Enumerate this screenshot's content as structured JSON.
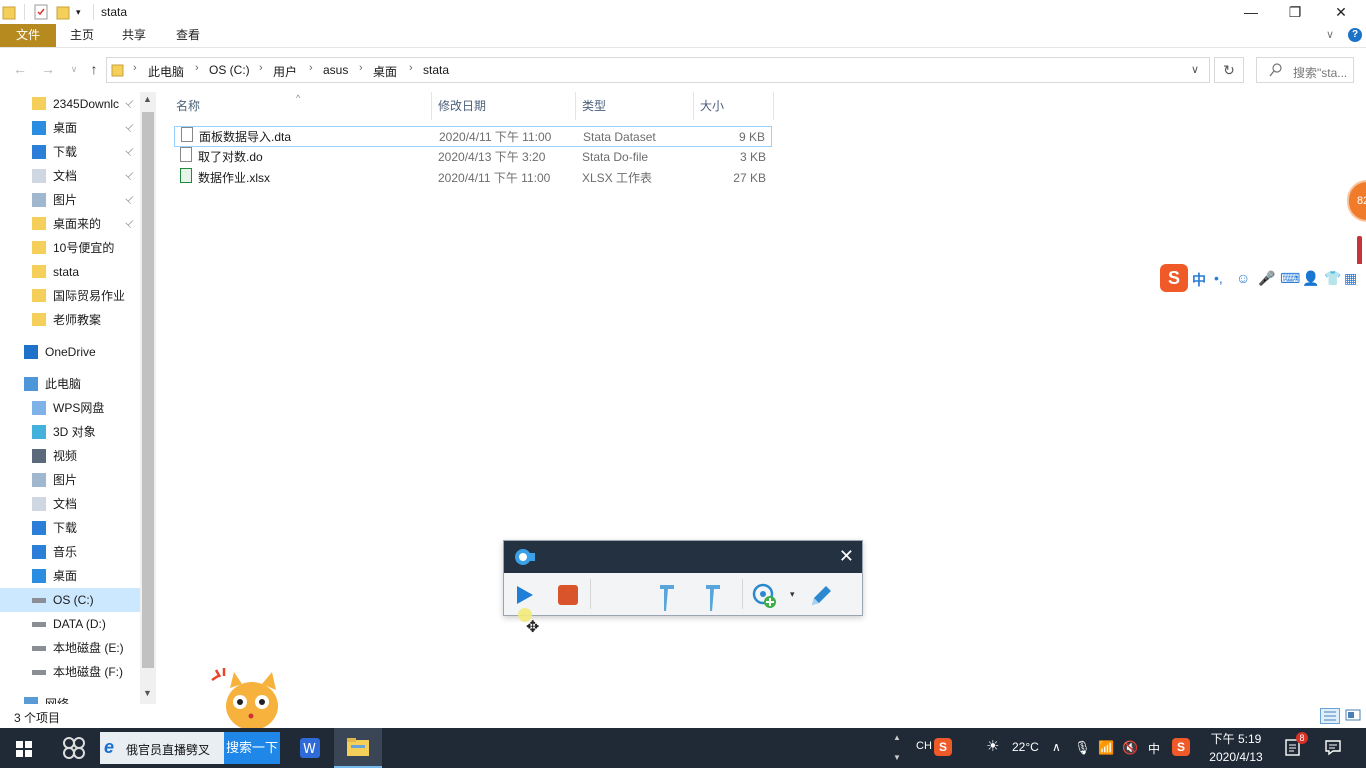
{
  "window": {
    "title": "stata",
    "minimize_icon": "minimize-icon",
    "maximize_icon": "restore-icon",
    "close_icon": "close-icon",
    "min_glyph": "—",
    "max_glyph": "❐",
    "close_glyph": "✕"
  },
  "ribbon": {
    "tabs": [
      "文件",
      "主页",
      "共享",
      "查看"
    ],
    "help_glyph": "?",
    "expand_glyph": "∨"
  },
  "address": {
    "crumbs": [
      "此电脑",
      "OS (C:)",
      "用户",
      "asus",
      "桌面",
      "stata"
    ],
    "dropdown_glyph": "∨",
    "refresh_glyph": "↻",
    "search_placeholder": "搜索\"sta..."
  },
  "sidebar": {
    "items": [
      {
        "label": "2345Downlc",
        "pinned": true,
        "icon": "folder-icon"
      },
      {
        "label": "桌面",
        "pinned": true,
        "icon": "desktop-icon"
      },
      {
        "label": "下载",
        "pinned": true,
        "icon": "download-icon"
      },
      {
        "label": "文档",
        "pinned": true,
        "icon": "document-icon"
      },
      {
        "label": "图片",
        "pinned": true,
        "icon": "picture-icon"
      },
      {
        "label": "桌面来的",
        "pinned": true,
        "icon": "folder-icon"
      },
      {
        "label": "10号便宜的",
        "pinned": false,
        "icon": "folder-icon"
      },
      {
        "label": "stata",
        "pinned": false,
        "icon": "folder-icon"
      },
      {
        "label": "国际贸易作业",
        "pinned": false,
        "icon": "folder-icon"
      },
      {
        "label": "老师教案",
        "pinned": false,
        "icon": "folder-icon"
      },
      {
        "label": "OneDrive",
        "pinned": false,
        "icon": "cloud-icon"
      },
      {
        "label": "此电脑",
        "pinned": false,
        "icon": "computer-icon"
      },
      {
        "label": "WPS网盘",
        "pinned": false,
        "icon": "cloud-outline-icon"
      },
      {
        "label": "3D 对象",
        "pinned": false,
        "icon": "cube-icon"
      },
      {
        "label": "视频",
        "pinned": false,
        "icon": "video-icon"
      },
      {
        "label": "图片",
        "pinned": false,
        "icon": "picture-icon"
      },
      {
        "label": "文档",
        "pinned": false,
        "icon": "document-icon"
      },
      {
        "label": "下载",
        "pinned": false,
        "icon": "download-icon"
      },
      {
        "label": "音乐",
        "pinned": false,
        "icon": "music-icon"
      },
      {
        "label": "桌面",
        "pinned": false,
        "icon": "desktop-icon"
      },
      {
        "label": "OS (C:)",
        "pinned": false,
        "icon": "drive-icon",
        "selected": true
      },
      {
        "label": "DATA (D:)",
        "pinned": false,
        "icon": "drive-icon"
      },
      {
        "label": "本地磁盘 (E:)",
        "pinned": false,
        "icon": "drive-icon"
      },
      {
        "label": "本地磁盘 (F:)",
        "pinned": false,
        "icon": "drive-icon"
      },
      {
        "label": "网络",
        "pinned": false,
        "icon": "network-icon"
      }
    ],
    "pin_glyph": "📌"
  },
  "filelist": {
    "columns": [
      "名称",
      "修改日期",
      "类型",
      "大小"
    ],
    "files": [
      {
        "name": "面板数据导入.dta",
        "date": "2020/4/11 下午 11:00",
        "type": "Stata Dataset",
        "size": "9 KB",
        "icon": "file-icon"
      },
      {
        "name": "取了对数.do",
        "date": "2020/4/13 下午 3:20",
        "type": "Stata Do-file",
        "size": "3 KB",
        "icon": "file-icon"
      },
      {
        "name": "数据作业.xlsx",
        "date": "2020/4/11 下午 11:00",
        "type": "XLSX 工作表",
        "size": "27 KB",
        "icon": "excel-file-icon"
      }
    ]
  },
  "status": {
    "item_count": "3 个项目"
  },
  "recorder": {
    "close_glyph": "✕"
  },
  "ime": {
    "lang": "中",
    "punct": "•,"
  },
  "taskbar": {
    "search_text": "俄官员直播劈叉",
    "search_button": "搜索一下",
    "input_lang": "CH",
    "temperature": "22°C",
    "ime_lang": "中",
    "time": "下午 5:19",
    "date": "2020/4/13",
    "notification_count": "8"
  },
  "floating_badge": "82"
}
